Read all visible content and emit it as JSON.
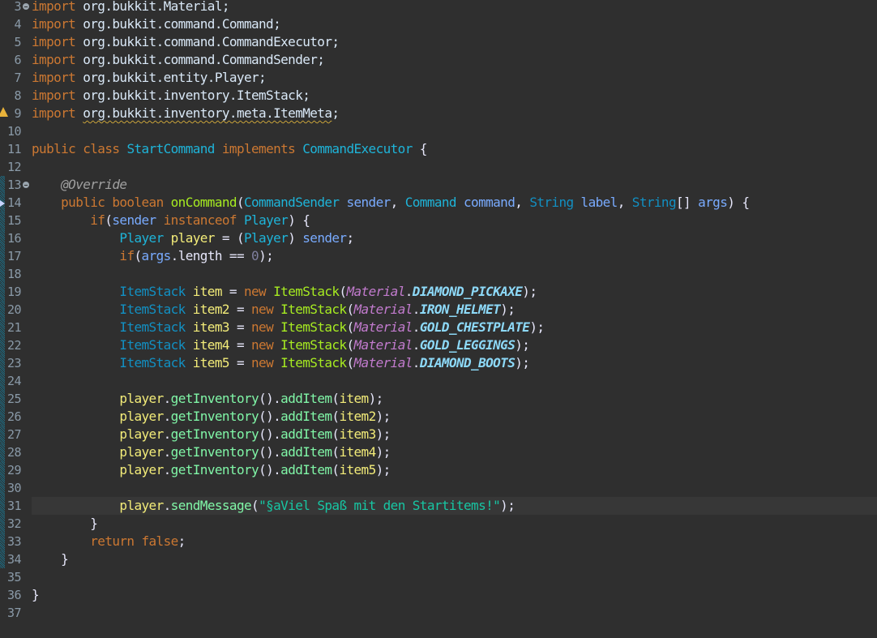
{
  "editor": {
    "language": "Java",
    "current_line": 31,
    "lines": [
      {
        "n": 3,
        "fold": true,
        "tokens": [
          [
            "kw",
            "import"
          ],
          [
            "pkg",
            " org.bukkit.Material;"
          ]
        ]
      },
      {
        "n": 4,
        "tokens": [
          [
            "kw",
            "import"
          ],
          [
            "pkg",
            " org.bukkit.command.Command;"
          ]
        ]
      },
      {
        "n": 5,
        "tokens": [
          [
            "kw",
            "import"
          ],
          [
            "pkg",
            " org.bukkit.command.CommandExecutor;"
          ]
        ]
      },
      {
        "n": 6,
        "tokens": [
          [
            "kw",
            "import"
          ],
          [
            "pkg",
            " org.bukkit.command.CommandSender;"
          ]
        ]
      },
      {
        "n": 7,
        "tokens": [
          [
            "kw",
            "import"
          ],
          [
            "pkg",
            " org.bukkit.entity.Player;"
          ]
        ]
      },
      {
        "n": 8,
        "tokens": [
          [
            "kw",
            "import"
          ],
          [
            "pkg",
            " org.bukkit.inventory.ItemStack;"
          ]
        ]
      },
      {
        "n": 9,
        "warning": true,
        "tokens": [
          [
            "kw",
            "import"
          ],
          [
            "pkg",
            " "
          ],
          [
            "pkg squiggle",
            "org.bukkit.inventory.meta.ItemMeta"
          ],
          [
            "pkg",
            ";"
          ]
        ]
      },
      {
        "n": 10,
        "tokens": []
      },
      {
        "n": 11,
        "tokens": [
          [
            "kw",
            "public class "
          ],
          [
            "cls",
            "StartCommand"
          ],
          [
            "kw",
            " implements "
          ],
          [
            "cls",
            "CommandExecutor"
          ],
          [
            "plain",
            " {"
          ]
        ]
      },
      {
        "n": 12,
        "tokens": []
      },
      {
        "n": 13,
        "fold": true,
        "changed": true,
        "tokens": [
          [
            "plain",
            "    "
          ],
          [
            "ann",
            "@Override"
          ]
        ]
      },
      {
        "n": 14,
        "changed": true,
        "override": true,
        "tokens": [
          [
            "plain",
            "    "
          ],
          [
            "kw",
            "public boolean "
          ],
          [
            "method",
            "onCommand"
          ],
          [
            "plain",
            "("
          ],
          [
            "cls",
            "CommandSender"
          ],
          [
            "param",
            " sender"
          ],
          [
            "plain",
            ", "
          ],
          [
            "cls",
            "Command"
          ],
          [
            "param",
            " command"
          ],
          [
            "plain",
            ", "
          ],
          [
            "type",
            "String"
          ],
          [
            "param",
            " label"
          ],
          [
            "plain",
            ", "
          ],
          [
            "type",
            "String"
          ],
          [
            "plain",
            "[]"
          ],
          [
            "param",
            " args"
          ],
          [
            "plain",
            ") {"
          ]
        ]
      },
      {
        "n": 15,
        "changed": true,
        "tokens": [
          [
            "plain",
            "        "
          ],
          [
            "kw",
            "if"
          ],
          [
            "plain",
            "("
          ],
          [
            "param",
            "sender"
          ],
          [
            "kw",
            " instanceof "
          ],
          [
            "cls",
            "Player"
          ],
          [
            "plain",
            ") {"
          ]
        ]
      },
      {
        "n": 16,
        "changed": true,
        "tokens": [
          [
            "plain",
            "            "
          ],
          [
            "cls",
            "Player"
          ],
          [
            "var",
            " player"
          ],
          [
            "plain",
            " = ("
          ],
          [
            "cls",
            "Player"
          ],
          [
            "plain",
            ") "
          ],
          [
            "param",
            "sender"
          ],
          [
            "plain",
            ";"
          ]
        ]
      },
      {
        "n": 17,
        "changed": true,
        "tokens": [
          [
            "plain",
            "            "
          ],
          [
            "kw",
            "if"
          ],
          [
            "plain",
            "("
          ],
          [
            "param",
            "args"
          ],
          [
            "plain",
            ".length == "
          ],
          [
            "num",
            "0"
          ],
          [
            "plain",
            ");"
          ]
        ]
      },
      {
        "n": 18,
        "changed": true,
        "tokens": []
      },
      {
        "n": 19,
        "changed": true,
        "tokens": [
          [
            "plain",
            "            "
          ],
          [
            "type",
            "ItemStack"
          ],
          [
            "var",
            " item"
          ],
          [
            "plain",
            " = "
          ],
          [
            "kw",
            "new "
          ],
          [
            "method",
            "ItemStack"
          ],
          [
            "plain",
            "("
          ],
          [
            "enumcls",
            "Material"
          ],
          [
            "plain",
            "."
          ],
          [
            "enumval",
            "DIAMOND_PICKAXE"
          ],
          [
            "plain",
            ");"
          ]
        ]
      },
      {
        "n": 20,
        "changed": true,
        "tokens": [
          [
            "plain",
            "            "
          ],
          [
            "type",
            "ItemStack"
          ],
          [
            "var",
            " item2"
          ],
          [
            "plain",
            " = "
          ],
          [
            "kw",
            "new "
          ],
          [
            "method",
            "ItemStack"
          ],
          [
            "plain",
            "("
          ],
          [
            "enumcls",
            "Material"
          ],
          [
            "plain",
            "."
          ],
          [
            "enumval",
            "IRON_HELMET"
          ],
          [
            "plain",
            ");"
          ]
        ]
      },
      {
        "n": 21,
        "changed": true,
        "tokens": [
          [
            "plain",
            "            "
          ],
          [
            "type",
            "ItemStack"
          ],
          [
            "var",
            " item3"
          ],
          [
            "plain",
            " = "
          ],
          [
            "kw",
            "new "
          ],
          [
            "method",
            "ItemStack"
          ],
          [
            "plain",
            "("
          ],
          [
            "enumcls",
            "Material"
          ],
          [
            "plain",
            "."
          ],
          [
            "enumval",
            "GOLD_CHESTPLATE"
          ],
          [
            "plain",
            ");"
          ]
        ]
      },
      {
        "n": 22,
        "changed": true,
        "tokens": [
          [
            "plain",
            "            "
          ],
          [
            "type",
            "ItemStack"
          ],
          [
            "var",
            " item4"
          ],
          [
            "plain",
            " = "
          ],
          [
            "kw",
            "new "
          ],
          [
            "method",
            "ItemStack"
          ],
          [
            "plain",
            "("
          ],
          [
            "enumcls",
            "Material"
          ],
          [
            "plain",
            "."
          ],
          [
            "enumval",
            "GOLD_LEGGINGS"
          ],
          [
            "plain",
            ");"
          ]
        ]
      },
      {
        "n": 23,
        "changed": true,
        "tokens": [
          [
            "plain",
            "            "
          ],
          [
            "type",
            "ItemStack"
          ],
          [
            "var",
            " item5"
          ],
          [
            "plain",
            " = "
          ],
          [
            "kw",
            "new "
          ],
          [
            "method",
            "ItemStack"
          ],
          [
            "plain",
            "("
          ],
          [
            "enumcls",
            "Material"
          ],
          [
            "plain",
            "."
          ],
          [
            "enumval",
            "DIAMOND_BOOTS"
          ],
          [
            "plain",
            ");"
          ]
        ]
      },
      {
        "n": 24,
        "changed": true,
        "tokens": []
      },
      {
        "n": 25,
        "changed": true,
        "tokens": [
          [
            "plain",
            "            "
          ],
          [
            "var",
            "player"
          ],
          [
            "plain",
            "."
          ],
          [
            "method2",
            "getInventory"
          ],
          [
            "plain",
            "()."
          ],
          [
            "method2",
            "addItem"
          ],
          [
            "plain",
            "("
          ],
          [
            "var",
            "item"
          ],
          [
            "plain",
            ");"
          ]
        ]
      },
      {
        "n": 26,
        "changed": true,
        "tokens": [
          [
            "plain",
            "            "
          ],
          [
            "var",
            "player"
          ],
          [
            "plain",
            "."
          ],
          [
            "method2",
            "getInventory"
          ],
          [
            "plain",
            "()."
          ],
          [
            "method2",
            "addItem"
          ],
          [
            "plain",
            "("
          ],
          [
            "var",
            "item2"
          ],
          [
            "plain",
            ");"
          ]
        ]
      },
      {
        "n": 27,
        "changed": true,
        "tokens": [
          [
            "plain",
            "            "
          ],
          [
            "var",
            "player"
          ],
          [
            "plain",
            "."
          ],
          [
            "method2",
            "getInventory"
          ],
          [
            "plain",
            "()."
          ],
          [
            "method2",
            "addItem"
          ],
          [
            "plain",
            "("
          ],
          [
            "var",
            "item3"
          ],
          [
            "plain",
            ");"
          ]
        ]
      },
      {
        "n": 28,
        "changed": true,
        "tokens": [
          [
            "plain",
            "            "
          ],
          [
            "var",
            "player"
          ],
          [
            "plain",
            "."
          ],
          [
            "method2",
            "getInventory"
          ],
          [
            "plain",
            "()."
          ],
          [
            "method2",
            "addItem"
          ],
          [
            "plain",
            "("
          ],
          [
            "var",
            "item4"
          ],
          [
            "plain",
            ");"
          ]
        ]
      },
      {
        "n": 29,
        "changed": true,
        "tokens": [
          [
            "plain",
            "            "
          ],
          [
            "var",
            "player"
          ],
          [
            "plain",
            "."
          ],
          [
            "method2",
            "getInventory"
          ],
          [
            "plain",
            "()."
          ],
          [
            "method2",
            "addItem"
          ],
          [
            "plain",
            "("
          ],
          [
            "var",
            "item5"
          ],
          [
            "plain",
            ");"
          ]
        ]
      },
      {
        "n": 30,
        "changed": true,
        "tokens": []
      },
      {
        "n": 31,
        "changed": true,
        "tokens": [
          [
            "plain",
            "            "
          ],
          [
            "var",
            "player"
          ],
          [
            "plain",
            "."
          ],
          [
            "method2",
            "sendMessage"
          ],
          [
            "plain",
            "("
          ],
          [
            "str",
            "\"§aViel Spaß mit den Startitems!\""
          ],
          [
            "plain",
            ");"
          ]
        ]
      },
      {
        "n": 32,
        "changed": true,
        "tokens": [
          [
            "plain",
            "        }"
          ]
        ]
      },
      {
        "n": 33,
        "changed": true,
        "tokens": [
          [
            "plain",
            "        "
          ],
          [
            "kw",
            "return false"
          ],
          [
            "plain",
            ";"
          ]
        ]
      },
      {
        "n": 34,
        "changed": true,
        "tokens": [
          [
            "plain",
            "    }"
          ]
        ]
      },
      {
        "n": 35,
        "tokens": []
      },
      {
        "n": 36,
        "tokens": [
          [
            "plain",
            "}"
          ]
        ]
      },
      {
        "n": 37,
        "tokens": []
      }
    ]
  }
}
